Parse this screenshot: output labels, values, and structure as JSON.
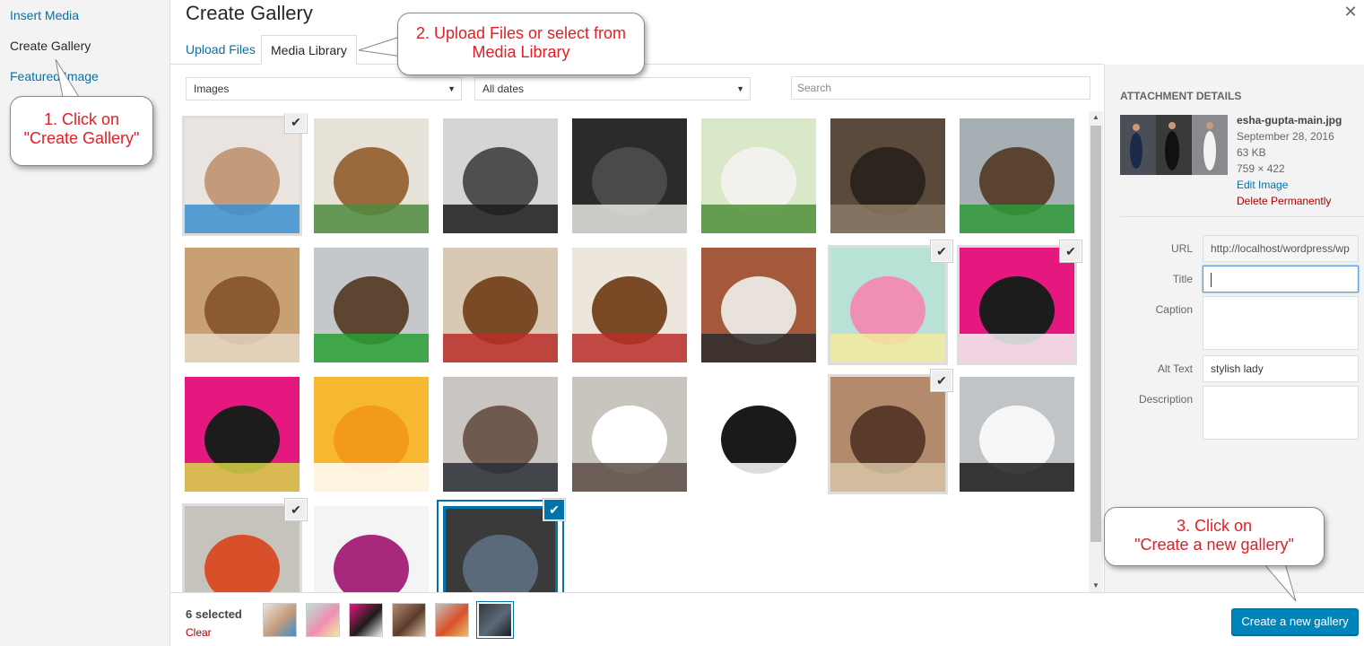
{
  "menu": {
    "items": [
      {
        "label": "Insert Media",
        "active": false
      },
      {
        "label": "Create Gallery",
        "active": true
      },
      {
        "label": "Featured Image",
        "active": false
      }
    ]
  },
  "header": {
    "title": "Create Gallery",
    "close_icon": "close-icon",
    "tabs": [
      {
        "label": "Upload Files",
        "active": false
      },
      {
        "label": "Media Library",
        "active": true
      }
    ]
  },
  "filters": {
    "type_select": "Images",
    "date_select": "All dates",
    "search_placeholder": "Search"
  },
  "attachments": [
    {
      "name": "woman-shopping-bags",
      "colors": [
        "#e9e4df",
        "#c39b7b",
        "#3a8fd0"
      ],
      "selected": true
    },
    {
      "name": "wooden-cattery-birdhouse",
      "colors": [
        "#e7e2d8",
        "#9b6a3c",
        "#4d8a3f"
      ],
      "selected": false
    },
    {
      "name": "black-cat-silhouette-bed",
      "colors": [
        "#d5d5d5",
        "#4f4f4f",
        "#1b1b1b"
      ],
      "selected": false
    },
    {
      "name": "black-white-cat-pillow",
      "colors": [
        "#2b2b2b",
        "#4a4a4a",
        "#e8e6e2"
      ],
      "selected": false
    },
    {
      "name": "white-cat-grass",
      "colors": [
        "#d8e8c9",
        "#f3f1ec",
        "#4f8f3a"
      ],
      "selected": false
    },
    {
      "name": "kittens-pile",
      "colors": [
        "#5a4a3c",
        "#2c241d",
        "#8c7a66"
      ],
      "selected": false
    },
    {
      "name": "cattery-green-floor",
      "colors": [
        "#a6b0b4",
        "#5a4330",
        "#2f9a3a"
      ],
      "selected": false
    },
    {
      "name": "kitten-on-couch",
      "colors": [
        "#c8a074",
        "#8b5a30",
        "#e8d8c4"
      ],
      "selected": false
    },
    {
      "name": "cattery-pool",
      "colors": [
        "#c5c8ca",
        "#5c4632",
        "#29a034"
      ],
      "selected": false
    },
    {
      "name": "cat-red-blanket",
      "colors": [
        "#d8c8b4",
        "#7a4a26",
        "#b82e28"
      ],
      "selected": false
    },
    {
      "name": "cat-red-blanket-2",
      "colors": [
        "#ece6dc",
        "#7a4a26",
        "#b82e28"
      ],
      "selected": false
    },
    {
      "name": "cat-man-tie",
      "colors": [
        "#a45a3a",
        "#e8e2da",
        "#2c2c2c"
      ],
      "selected": false
    },
    {
      "name": "pink-umbrella-woman",
      "colors": [
        "#b9e2d6",
        "#ef8fb3",
        "#f3ea9f"
      ],
      "selected": true
    },
    {
      "name": "fashion-silhouettes-pink",
      "colors": [
        "#e4187e",
        "#1c1c1c",
        "#f3f3f3"
      ],
      "selected": true
    },
    {
      "name": "fashion-silhouettes-pink-2",
      "colors": [
        "#e4187e",
        "#1c1c1c",
        "#d6d64a"
      ],
      "selected": false
    },
    {
      "name": "orange-swoosh",
      "colors": [
        "#f6b830",
        "#f39a1a",
        "#ffffff"
      ],
      "selected": false
    },
    {
      "name": "man-portrait",
      "colors": [
        "#c9c5c0",
        "#6f5b4d",
        "#2a2f36"
      ],
      "selected": false
    },
    {
      "name": "women-white-dresses",
      "colors": [
        "#c8c4be",
        "#ffffff",
        "#5a4e46"
      ],
      "selected": false
    },
    {
      "name": "shoe-silhouettes",
      "colors": [
        "#ffffff",
        "#1a1a1a",
        "#ffffff"
      ],
      "selected": false
    },
    {
      "name": "rings-bracelets-hands",
      "colors": [
        "#b48a6c",
        "#5a3a2a",
        "#d8c4a6"
      ],
      "selected": true
    },
    {
      "name": "woman-walking-street",
      "colors": [
        "#c0c4c6",
        "#f6f6f6",
        "#1c1c1c"
      ],
      "selected": false
    },
    {
      "name": "bridal-lehenga",
      "colors": [
        "#c6c2bc",
        "#d8502a",
        "#e8c06a"
      ],
      "selected": true
    },
    {
      "name": "fashion-splash-text",
      "colors": [
        "#f4f4f4",
        "#a8287e",
        "#5a2a7a"
      ],
      "selected": false
    },
    {
      "name": "esha-gupta-main",
      "colors": [
        "#3a3a3a",
        "#5a6a7a",
        "#1c1c22"
      ],
      "selected": true,
      "current": true
    }
  ],
  "details": {
    "heading": "Attachment Details",
    "filename": "esha-gupta-main.jpg",
    "date": "September 28, 2016",
    "size": "63 KB",
    "dimensions": "759 × 422",
    "edit_link": "Edit Image",
    "delete_link": "Delete Permanently",
    "fields": {
      "url_label": "URL",
      "url_value": "http://localhost/wordpress/wp",
      "title_label": "Title",
      "title_value": "",
      "caption_label": "Caption",
      "caption_value": "",
      "alt_label": "Alt Text",
      "alt_value": "stylish lady",
      "description_label": "Description",
      "description_value": ""
    }
  },
  "footer": {
    "selected_count": "6 selected",
    "clear_label": "Clear",
    "create_button": "Create a new gallery"
  },
  "callouts": {
    "step1_line1": "1. Click on",
    "step1_line2": "\"Create Gallery\"",
    "step2_line1": "2. Upload Files or select from",
    "step2_line2": "Media Library",
    "step3_line1": "3. Click on",
    "step3_line2": "\"Create a new gallery\""
  },
  "colors": {
    "accent": "#0073aa",
    "primary_button": "#0085ba",
    "callout_text": "#e31e24",
    "delete": "#a00"
  }
}
